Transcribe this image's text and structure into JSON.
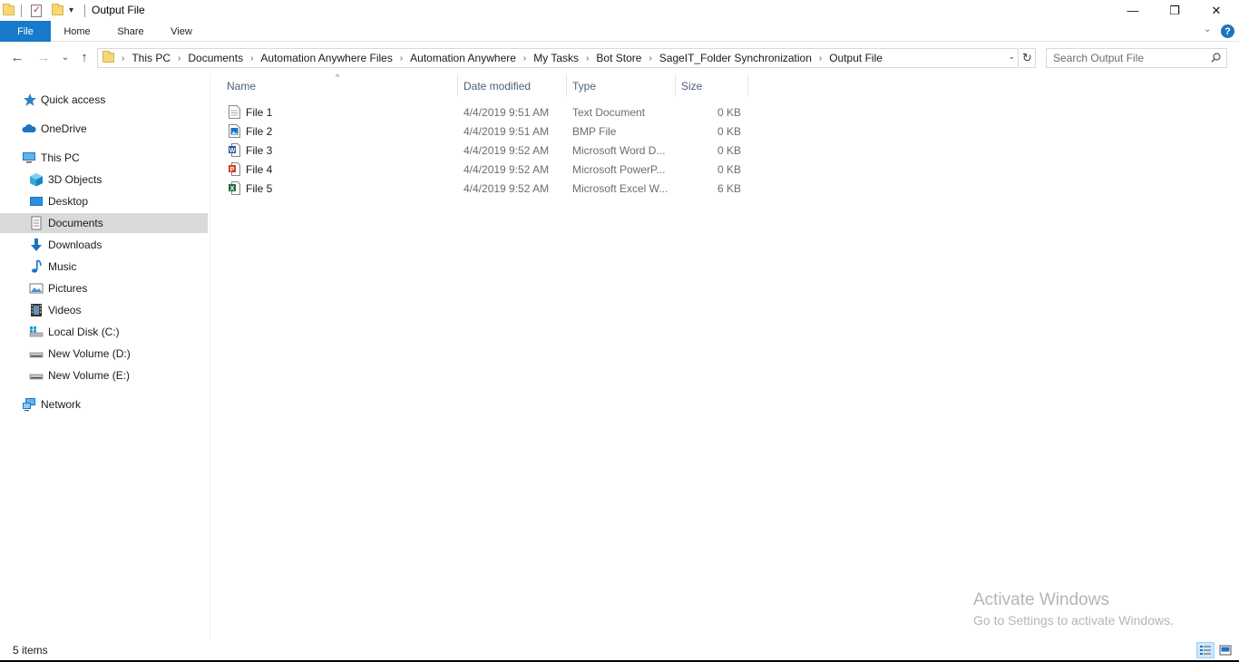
{
  "window": {
    "title": "Output File",
    "controls": {
      "minimize": "—",
      "restore": "❐",
      "close": "✕"
    }
  },
  "quick_access_toolbar": {
    "dropdown": "▾"
  },
  "ribbon": {
    "tabs": [
      "File",
      "Home",
      "Share",
      "View"
    ],
    "expand_chevron": "⌄",
    "help": "?"
  },
  "navigation": {
    "back": "←",
    "forward": "→",
    "recent": "⌄",
    "up": "↑",
    "breadcrumb": [
      "This PC",
      "Documents",
      "Automation Anywhere Files",
      "Automation Anywhere",
      "My Tasks",
      "Bot Store",
      "SageIT_Folder Synchronization",
      "Output File"
    ],
    "breadcrumb_separator": "›",
    "address_dropdown": "⌄",
    "refresh": "↻"
  },
  "search": {
    "placeholder": "Search Output File"
  },
  "nav_pane": {
    "quick_access": "Quick access",
    "onedrive": "OneDrive",
    "this_pc": "This PC",
    "this_pc_items": [
      "3D Objects",
      "Desktop",
      "Documents",
      "Downloads",
      "Music",
      "Pictures",
      "Videos",
      "Local Disk (C:)",
      "New Volume (D:)",
      "New Volume (E:)"
    ],
    "network": "Network",
    "selected": "Documents"
  },
  "file_list": {
    "columns": {
      "name": "Name",
      "date": "Date modified",
      "type": "Type",
      "size": "Size"
    },
    "sort_indicator": "^",
    "rows": [
      {
        "name": "File 1",
        "date": "4/4/2019 9:51 AM",
        "type": "Text Document",
        "size": "0 KB",
        "icon": "text-document-icon"
      },
      {
        "name": "File 2",
        "date": "4/4/2019 9:51 AM",
        "type": "BMP File",
        "size": "0 KB",
        "icon": "bmp-image-icon"
      },
      {
        "name": "File 3",
        "date": "4/4/2019 9:52 AM",
        "type": "Microsoft Word D...",
        "size": "0 KB",
        "icon": "word-document-icon"
      },
      {
        "name": "File 4",
        "date": "4/4/2019 9:52 AM",
        "type": "Microsoft PowerP...",
        "size": "0 KB",
        "icon": "powerpoint-document-icon"
      },
      {
        "name": "File 5",
        "date": "4/4/2019 9:52 AM",
        "type": "Microsoft Excel W...",
        "size": "6 KB",
        "icon": "excel-document-icon"
      }
    ]
  },
  "status": {
    "item_count": "5 items"
  },
  "watermark": {
    "line1": "Activate Windows",
    "line2": "Go to Settings to activate Windows."
  },
  "colors": {
    "accent": "#1979ca",
    "selection": "#d9d9d9",
    "header_text": "#4c607a"
  }
}
